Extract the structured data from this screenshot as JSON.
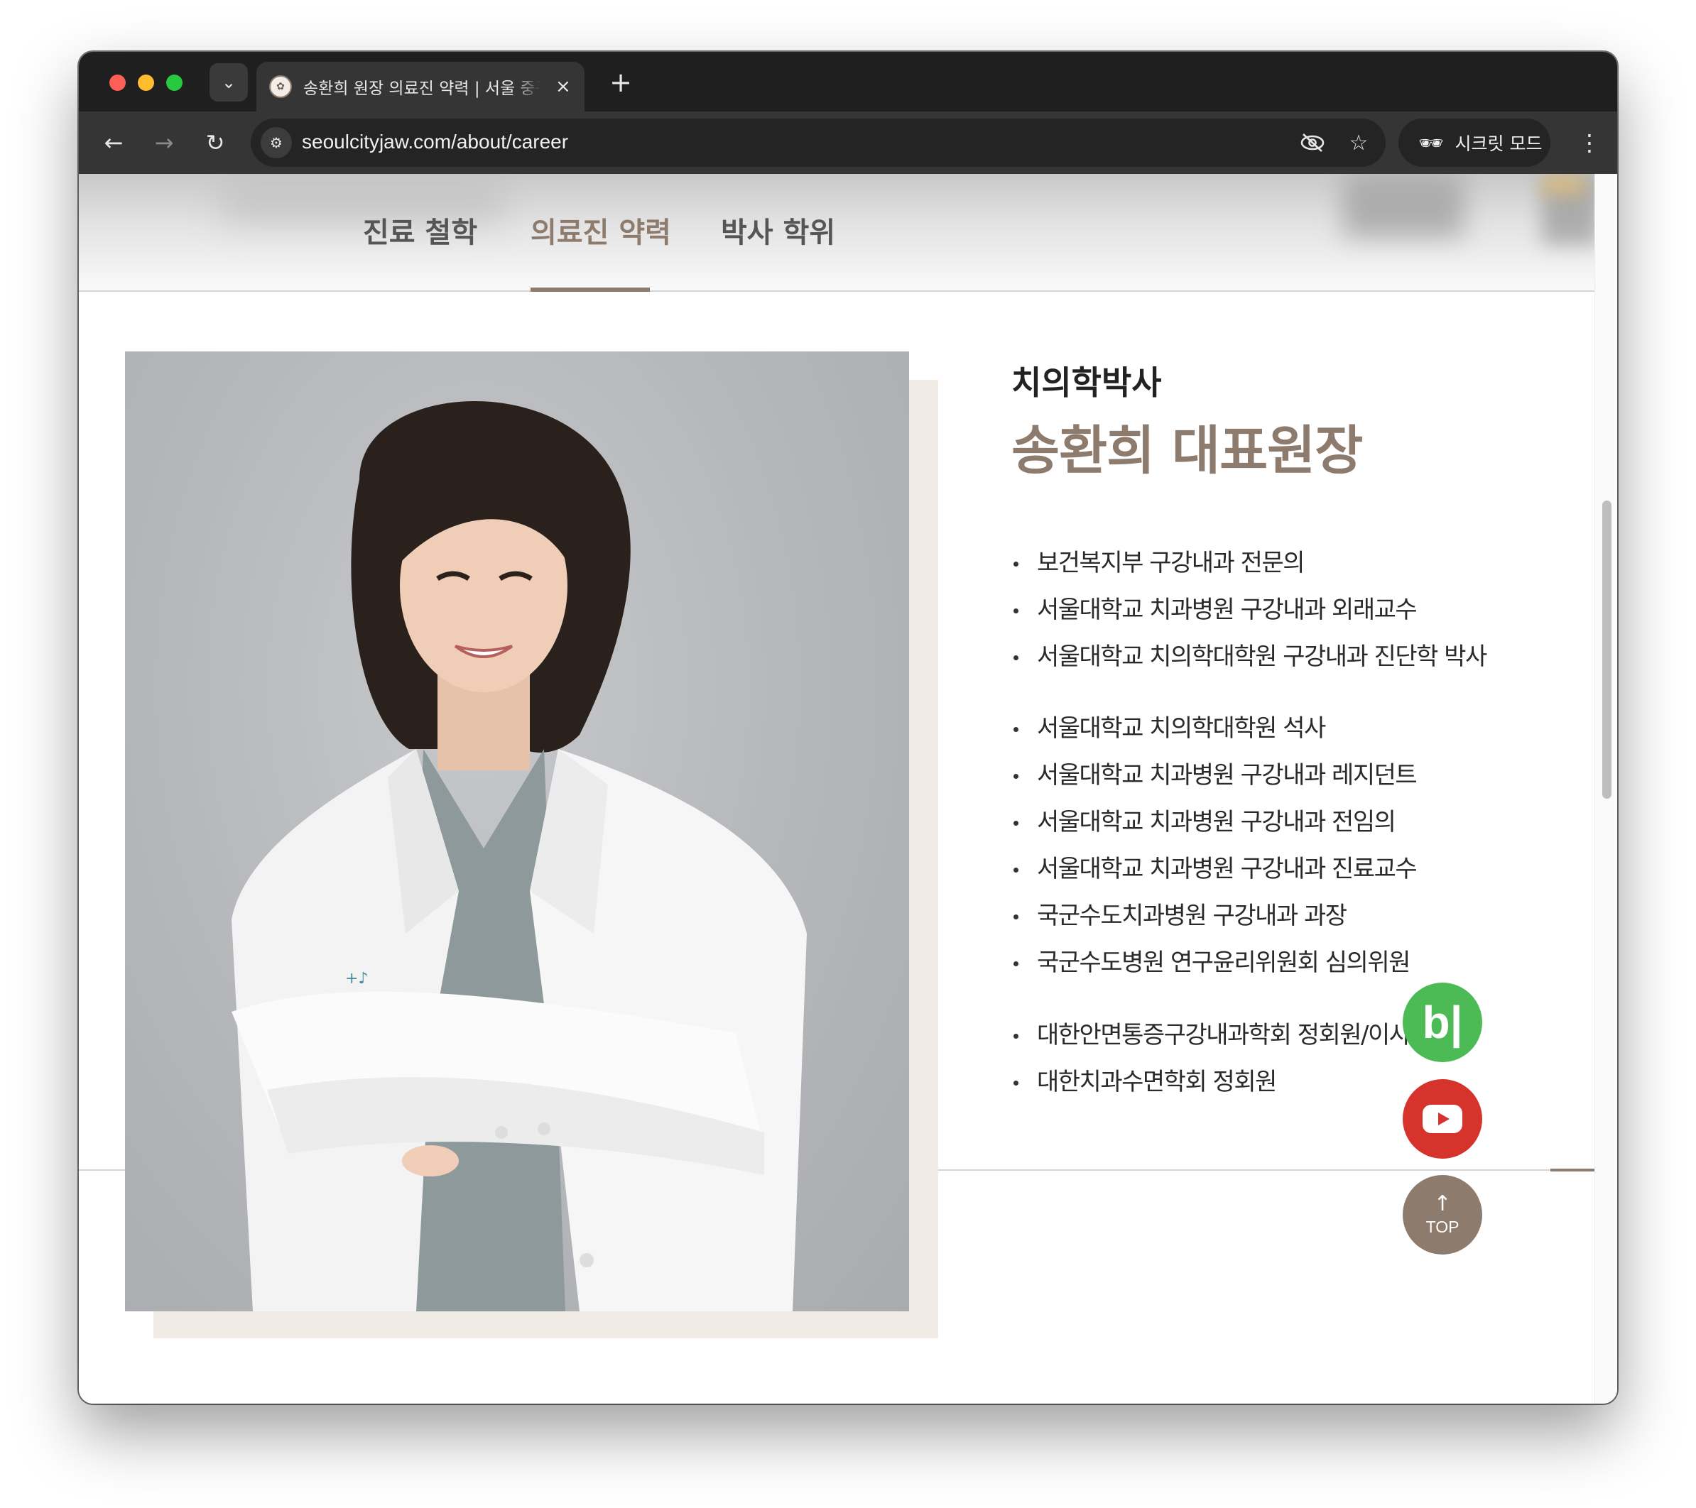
{
  "browser": {
    "tab": {
      "title": "송환희 원장 의료진 약력 | 서울 중구",
      "close_icon": "×"
    },
    "new_tab_icon": "+",
    "url": "seoulcityjaw.com/about/career",
    "incognito_label": "시크릿 모드"
  },
  "subnav": {
    "items": [
      {
        "label": "진료 철학"
      },
      {
        "label": "의료진 약력"
      },
      {
        "label": "박사 학위"
      }
    ],
    "active_index": 1
  },
  "profile": {
    "degree": "치의학박사",
    "name": "송환희 대표원장",
    "career_groups": [
      [
        "보건복지부 구강내과 전문의",
        "서울대학교 치과병원 구강내과 외래교수",
        "서울대학교 치의학대학원 구강내과 진단학 박사"
      ],
      [
        "서울대학교 치의학대학원 석사",
        "서울대학교 치과병원 구강내과 레지던트",
        "서울대학교 치과병원 구강내과 전임의",
        "서울대학교 치과병원 구강내과 진료교수",
        "국군수도치과병원 구강내과 과장",
        "국군수도병원 연구윤리위원회 심의위원"
      ],
      [
        "대한안면통증구강내과학회 정회원/이사",
        "대한치과수면학회 정회원"
      ]
    ]
  },
  "floating": {
    "blog_label": "b|",
    "top_label": "TOP"
  },
  "colors": {
    "accent": "#8d7b6e",
    "blog_green": "#4cbb55",
    "youtube_red": "#d6332c",
    "photo_frame": "#f0ebe5"
  }
}
